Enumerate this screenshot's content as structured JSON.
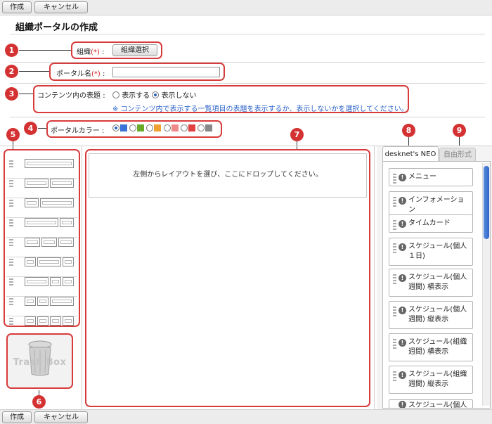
{
  "toolbar": {
    "create_label": "作成",
    "cancel_label": "キャンセル"
  },
  "page": {
    "title": "組織ポータルの作成"
  },
  "form": {
    "org_label": "組織",
    "required_mark": "(*)",
    "colon": ":",
    "org_select_button": "組織選択",
    "portal_name_label": "ポータル名",
    "portal_name_value": "",
    "heading_label": "コンテンツ内の表題",
    "heading_show": "表示する",
    "heading_hide": "表示しない",
    "heading_note": "※ コンテンツ内で表示する一覧項目の表題を表示するか、表示しないかを選択してください。",
    "color_label": "ポータルカラー",
    "colors": [
      "#3a74d8",
      "#6aaa2a",
      "#f0a030",
      "#f08a8a",
      "#e04040",
      "#888888"
    ]
  },
  "badges": [
    "1",
    "2",
    "3",
    "4",
    "5",
    "6",
    "7",
    "8",
    "9"
  ],
  "drop_area": {
    "message": "左側からレイアウトを選び、ここにドロップしてください。"
  },
  "trash": {
    "label": "Trash Box"
  },
  "tabs": {
    "neo": "desknet's NEO",
    "free": "自由形式"
  },
  "contents": [
    "メニュー",
    "インフォメーション",
    "タイムカード",
    "スケジュール(個人１日)",
    "スケジュール(個人週間) 横表示",
    "スケジュール(個人週間) 縦表示",
    "スケジュール(組織週間) 横表示",
    "スケジュール(組織週間) 縦表示",
    "スケジュール(個人月"
  ]
}
